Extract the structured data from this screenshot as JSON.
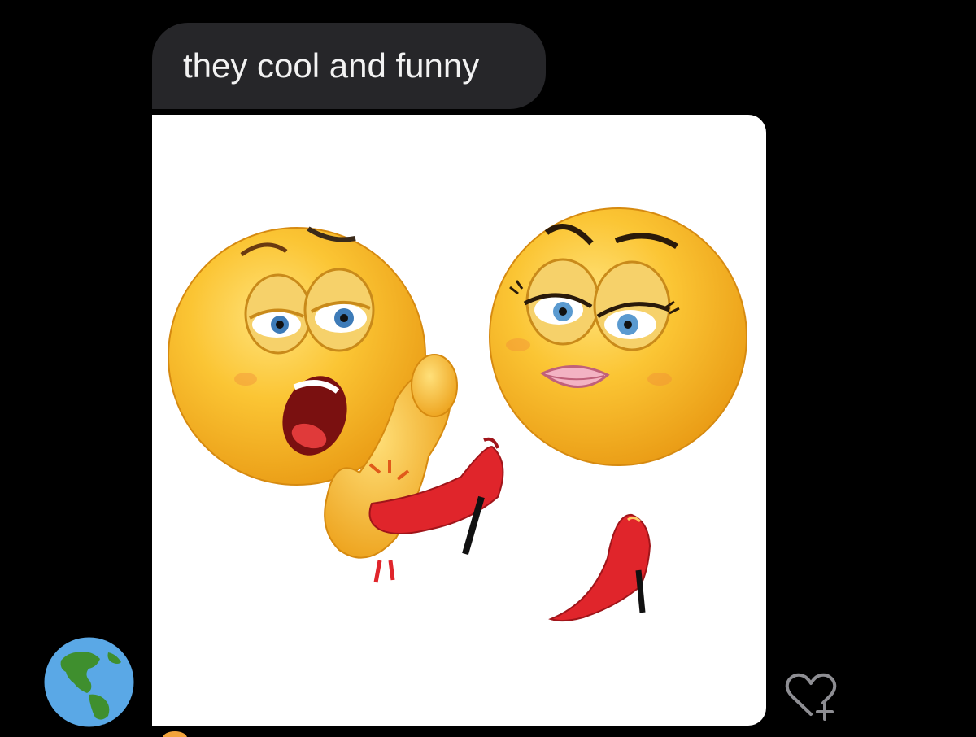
{
  "conversation": {
    "message_text": "they cool and funny",
    "attachment": {
      "kind": "image",
      "content": "two-emoji-faces-with-red-high-heels"
    },
    "sender_avatar_icon": "globe-americas-icon",
    "reaction_button_icon": "heart-plus-icon"
  },
  "colors": {
    "background": "#000000",
    "bubble": "#262629",
    "bubble_text": "#f2f2f2",
    "reaction_icon": "#8e8e93",
    "emoji_yellow": "#f7b728",
    "shoe_red": "#e0252b"
  }
}
